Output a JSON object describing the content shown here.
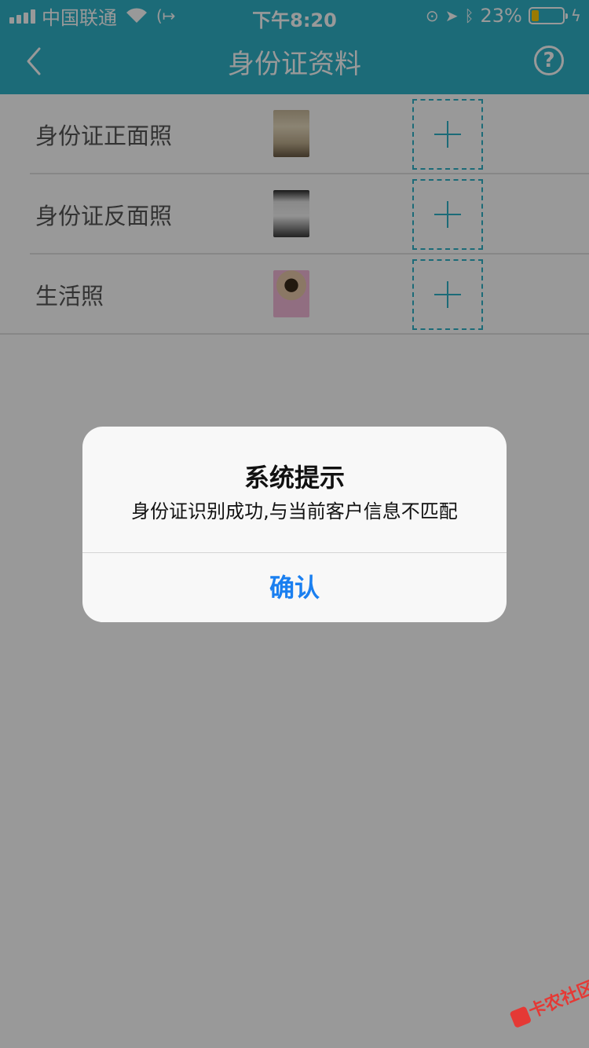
{
  "status_bar": {
    "carrier": "中国联通",
    "time": "下午8:20",
    "battery_percent_text": "23%",
    "battery_level": 0.23,
    "battery_color": "#ffcc00",
    "icons": [
      "signal-icon",
      "wifi-icon",
      "vpn-icon",
      "orientation-lock-icon",
      "location-icon",
      "bluetooth-icon",
      "battery-icon",
      "charging-icon"
    ]
  },
  "nav": {
    "title": "身份证资料",
    "back_icon": "chevron-left-icon",
    "help_label": "?",
    "background_color": "#2fb3c9"
  },
  "rows": [
    {
      "label": "身份证正面照",
      "thumbnail": "id-card-front-photo",
      "add_icon": "plus-icon"
    },
    {
      "label": "身份证反面照",
      "thumbnail": "id-card-back-photo",
      "add_icon": "plus-icon"
    },
    {
      "label": "生活照",
      "thumbnail": "life-photo",
      "add_icon": "plus-icon"
    }
  ],
  "alert": {
    "title": "系统提示",
    "message": "身份证识别成功,与当前客户信息不匹配",
    "confirm_label": "确认",
    "confirm_color": "#1a7ff0"
  },
  "watermark": {
    "text": "卡农社区",
    "color": "#e53935"
  }
}
